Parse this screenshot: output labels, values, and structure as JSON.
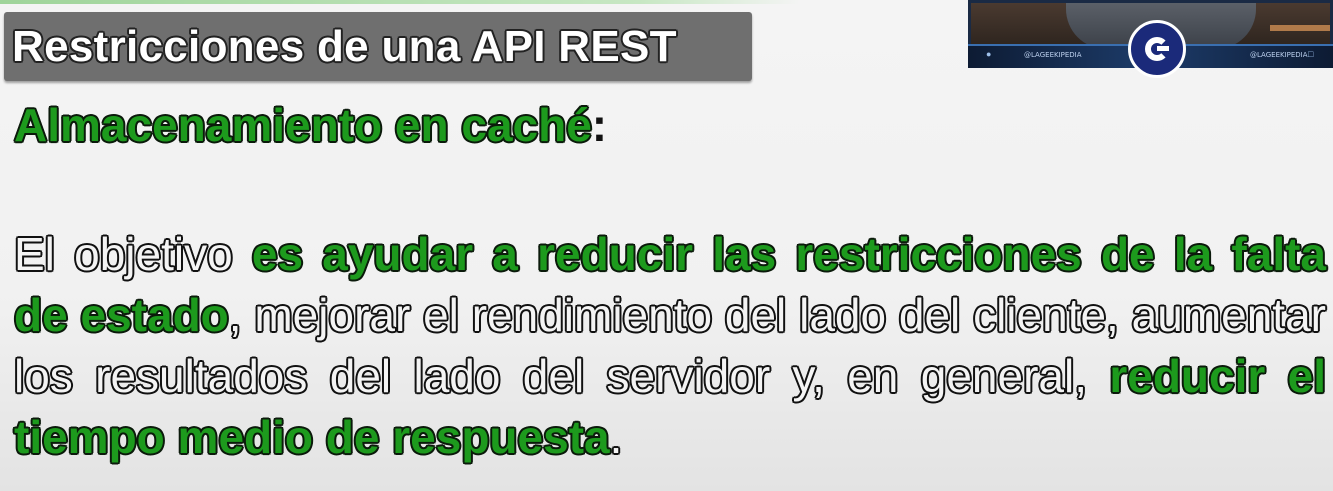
{
  "slide": {
    "title": "Restricciones de una API REST",
    "heading": {
      "highlight": "Almacenamiento en caché",
      "suffix": ":"
    },
    "paragraph": [
      {
        "text": "El objetivo ",
        "highlight": false
      },
      {
        "text": "es ayudar a reducir las restricciones de la falta de estado",
        "highlight": true
      },
      {
        "text": ", mejorar el rendimiento del lado del cliente, aumentar los resultados del lado del servidor y, en general, ",
        "highlight": false
      },
      {
        "text": "reducir el tiempo medio de respuesta",
        "highlight": true
      },
      {
        "text": ".",
        "highlight": false
      }
    ]
  },
  "webcam": {
    "handle_left": "@LAGEEKIPEDIA",
    "handle_right": "@LAGEEKIPEDIA",
    "icon_left": "twitter-icon",
    "icon_right": "instagram-icon",
    "logo": "lageekipedia-logo"
  },
  "colors": {
    "highlight": "#1d9a1d",
    "title_bar": "#6f6f6f",
    "background": "#f2f2f2"
  }
}
